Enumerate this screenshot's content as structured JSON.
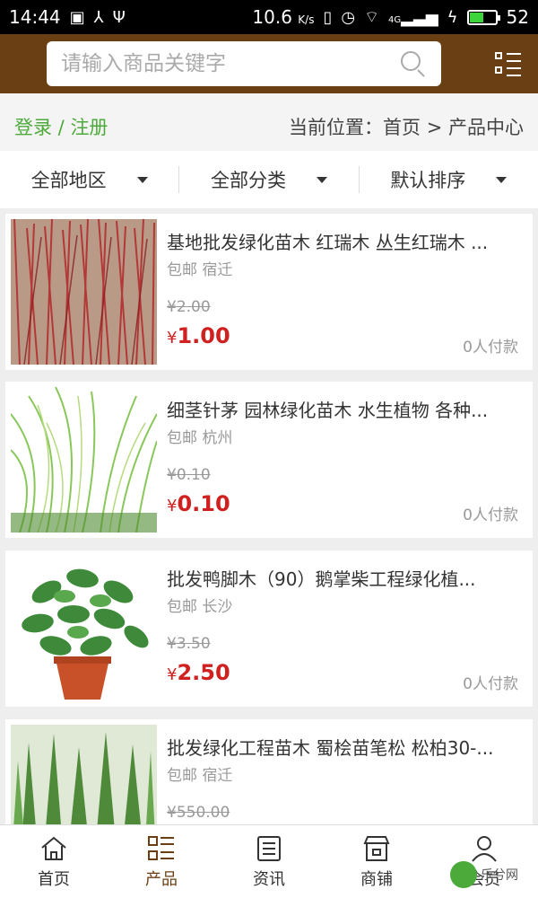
{
  "status_bar": {
    "time": "14:44",
    "speed": "10.6",
    "speed_unit": "K/s",
    "battery": "52",
    "network": "4G"
  },
  "header": {
    "search_placeholder": "请输入商品关键字"
  },
  "location_bar": {
    "login": "登录",
    "separator": " / ",
    "register": "注册",
    "breadcrumb": "当前位置：首页 > 产品中心"
  },
  "filters": [
    {
      "label": "全部地区"
    },
    {
      "label": "全部分类"
    },
    {
      "label": "默认排序"
    }
  ],
  "products": [
    {
      "title": "基地批发绿化苗木 红瑞木 丛生红瑞木 ...",
      "meta": "包邮 宿迁",
      "old_price": "¥2.00",
      "currency": "¥",
      "price": "1.00",
      "sold": "0人付款"
    },
    {
      "title": "细茎针茅 园林绿化苗木 水生植物 各种...",
      "meta": "包邮 杭州",
      "old_price": "¥0.10",
      "currency": "¥",
      "price": "0.10",
      "sold": "0人付款"
    },
    {
      "title": "批发鸭脚木（90）鹅掌柴工程绿化植...",
      "meta": "包邮 长沙",
      "old_price": "¥3.50",
      "currency": "¥",
      "price": "2.50",
      "sold": "0人付款"
    },
    {
      "title": "批发绿化工程苗木 蜀桧苗笔松 松柏30-...",
      "meta": "包邮 宿迁",
      "old_price": "¥550.00",
      "currency": "¥",
      "price": "",
      "sold": ""
    }
  ],
  "bottom_nav": [
    {
      "label": "首页",
      "icon": "home-icon"
    },
    {
      "label": "产品",
      "icon": "product-list-icon",
      "active": true
    },
    {
      "label": "资讯",
      "icon": "news-icon"
    },
    {
      "label": "商铺",
      "icon": "shop-icon"
    },
    {
      "label": "会员",
      "icon": "user-icon"
    }
  ],
  "watermark": {
    "text": "乐兮网"
  },
  "colors": {
    "header_bg": "#6b3f14",
    "accent_green": "#4caa3a",
    "price_red": "#d02020"
  }
}
